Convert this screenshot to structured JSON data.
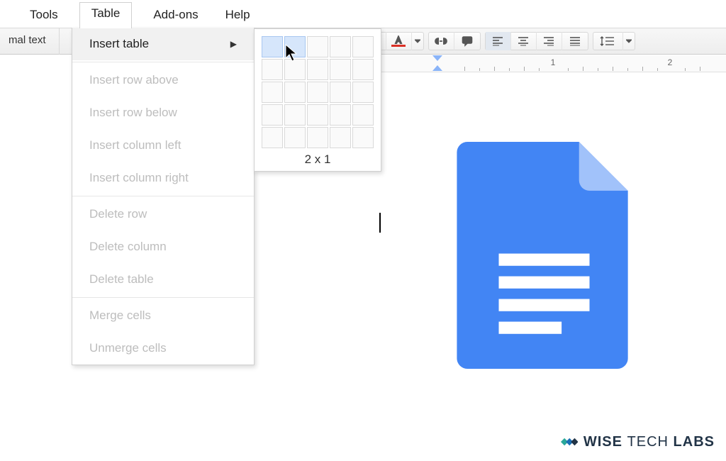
{
  "menubar": {
    "tools": "Tools",
    "table": "Table",
    "addons": "Add-ons",
    "help": "Help"
  },
  "toolbar": {
    "style_label": "mal text"
  },
  "dropdown": {
    "insert_table": "Insert table",
    "insert_row_above": "Insert row above",
    "insert_row_below": "Insert row below",
    "insert_col_left": "Insert column left",
    "insert_col_right": "Insert column right",
    "delete_row": "Delete row",
    "delete_column": "Delete column",
    "delete_table": "Delete table",
    "merge_cells": "Merge cells",
    "unmerge_cells": "Unmerge cells"
  },
  "table_picker": {
    "size_label": "2 x 1",
    "cols_selected": 2,
    "rows_selected": 1
  },
  "ruler": {
    "marks": [
      "1",
      "2"
    ]
  },
  "watermark": {
    "brand1": "WISE",
    "brand2": "TECH",
    "brand3": "LABS"
  },
  "colors": {
    "doc_blue": "#4285f4",
    "doc_fold": "#a1c2fa"
  }
}
